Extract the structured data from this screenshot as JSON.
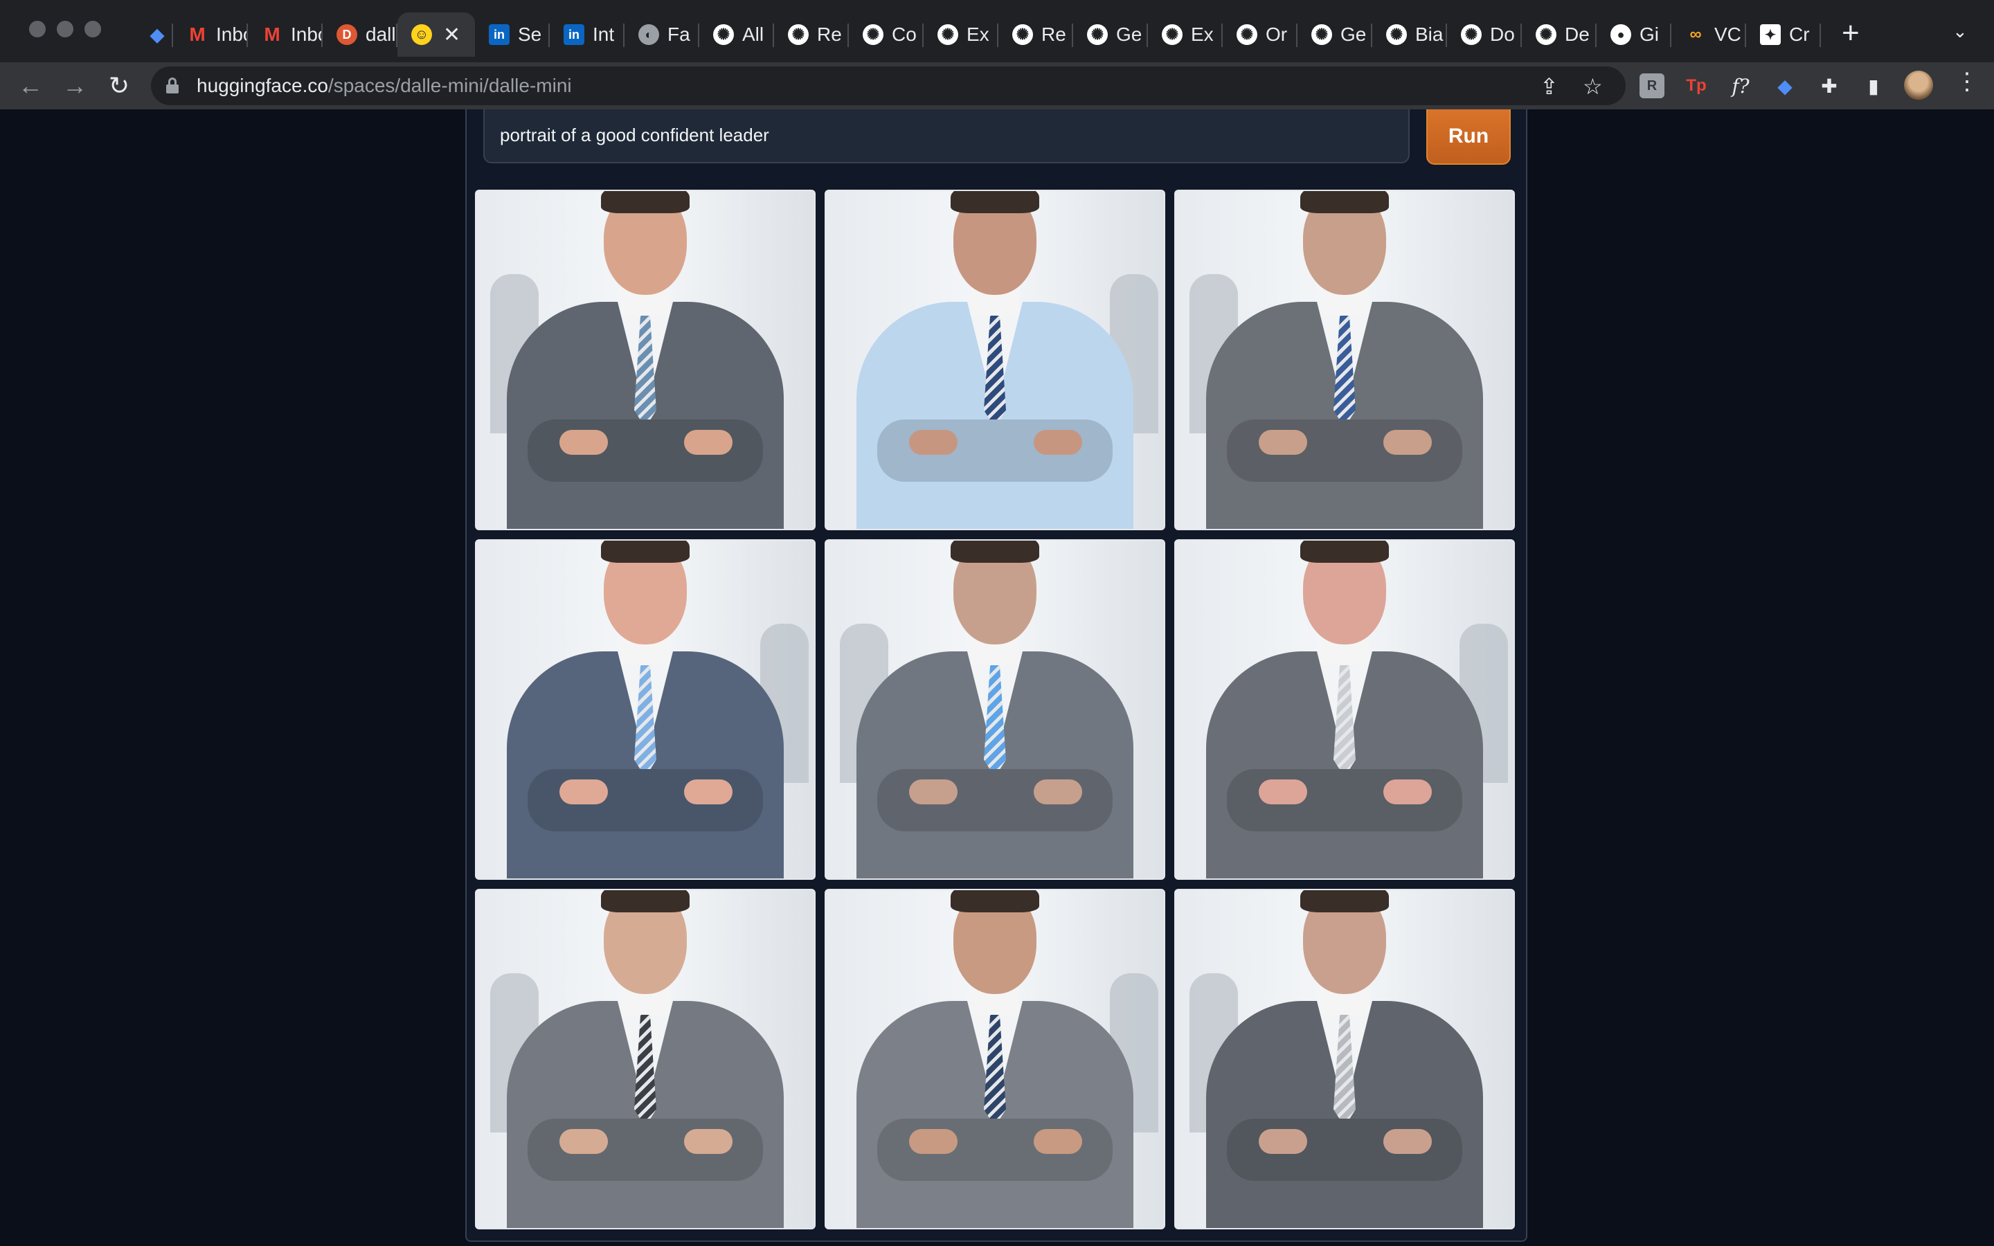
{
  "browser": {
    "tabs": [
      {
        "label": "",
        "icon": "gem-icon",
        "pinned": true
      },
      {
        "label": "Inbox",
        "icon": "gmail-icon"
      },
      {
        "label": "Inbox",
        "icon": "gmail-icon"
      },
      {
        "label": "dalle",
        "icon": "duckduckgo-icon"
      },
      {
        "label": "",
        "icon": "huggingface-icon",
        "active": true
      },
      {
        "label": "Se",
        "icon": "linkedin-icon"
      },
      {
        "label": "Int",
        "icon": "linkedin-icon"
      },
      {
        "label": "Fa",
        "icon": "globe-icon"
      },
      {
        "label": "All",
        "icon": "openai-icon"
      },
      {
        "label": "Re",
        "icon": "openai-icon"
      },
      {
        "label": "Co",
        "icon": "openai-icon"
      },
      {
        "label": "Ex",
        "icon": "openai-icon"
      },
      {
        "label": "Re",
        "icon": "openai-icon"
      },
      {
        "label": "Ge",
        "icon": "openai-icon"
      },
      {
        "label": "Ex",
        "icon": "openai-icon"
      },
      {
        "label": "Or",
        "icon": "openai-icon"
      },
      {
        "label": "Ge",
        "icon": "openai-icon"
      },
      {
        "label": "Bia",
        "icon": "openai-icon"
      },
      {
        "label": "Do",
        "icon": "openai-icon"
      },
      {
        "label": "De",
        "icon": "openai-icon"
      },
      {
        "label": "Gi",
        "icon": "github-icon"
      },
      {
        "label": "VC",
        "icon": "infinity-icon"
      },
      {
        "label": "Cr",
        "icon": "sparkle-icon"
      }
    ],
    "url_host": "huggingface.co",
    "url_path": "/spaces/dalle-mini/dalle-mini"
  },
  "app": {
    "prompt_value": "portrait of a good confident leader",
    "run_label": "Run",
    "accent_color": "#c9651f",
    "images": [
      {
        "alt": "generated-image-1",
        "suit": "#5f6670",
        "tie": "#6a8fb0",
        "skin": "#d8a58c"
      },
      {
        "alt": "generated-image-2",
        "suit": "#bcd6ee",
        "tie": "#2f4b7c",
        "skin": "#c79681"
      },
      {
        "alt": "generated-image-3",
        "suit": "#6c7077",
        "tie": "#3a5d99",
        "skin": "#c89f8a"
      },
      {
        "alt": "generated-image-4",
        "suit": "#56657c",
        "tie": "#7fb0e3",
        "skin": "#e0a996"
      },
      {
        "alt": "generated-image-5",
        "suit": "#717780",
        "tie": "#5ea4e6",
        "skin": "#c7a08d"
      },
      {
        "alt": "generated-image-6",
        "suit": "#6a6f77",
        "tie": "#c9ccd1",
        "skin": "#dca598"
      },
      {
        "alt": "generated-image-7",
        "suit": "#757a82",
        "tie": "#3b3f46",
        "skin": "#d6ab94"
      },
      {
        "alt": "generated-image-8",
        "suit": "#7c8189",
        "tie": "#2e4568",
        "skin": "#c89a82"
      },
      {
        "alt": "generated-image-9",
        "suit": "#60656d",
        "tie": "#b6b9be",
        "skin": "#c9a08e"
      }
    ]
  }
}
